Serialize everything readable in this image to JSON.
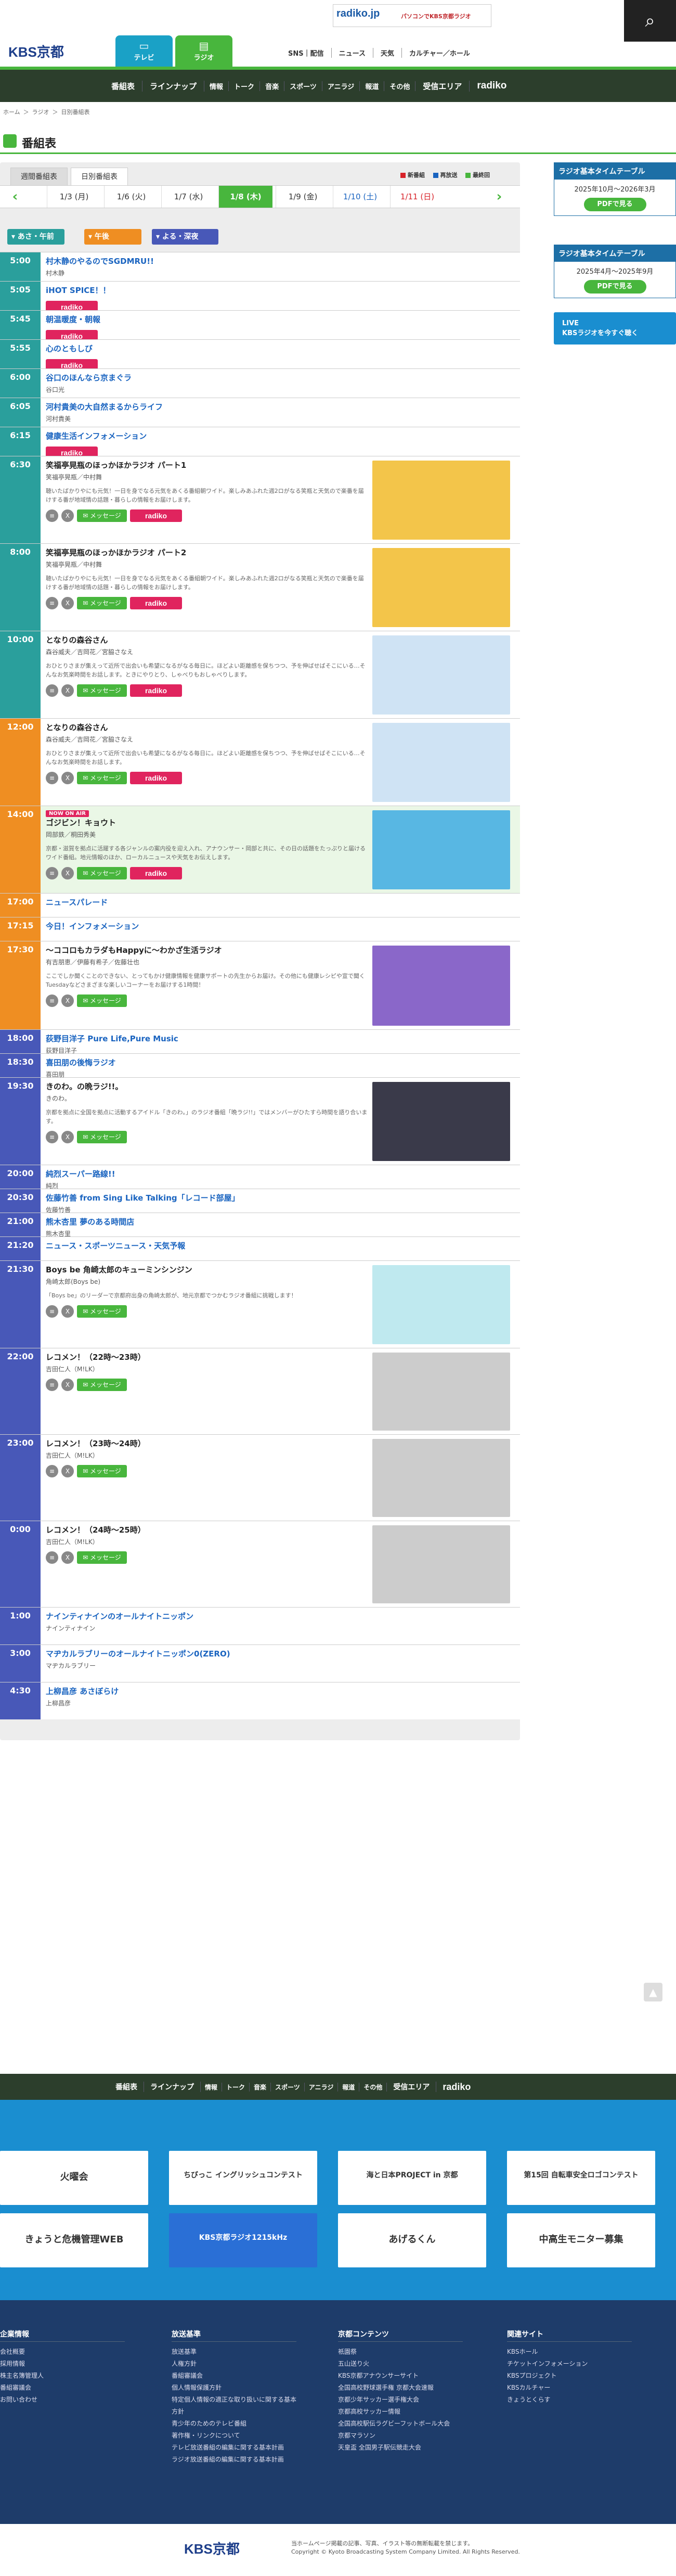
{
  "header": {
    "logo": "KBS京都",
    "tabs": [
      {
        "label": "テレビ",
        "icon": "tv-icon"
      },
      {
        "label": "ラジオ",
        "icon": "radio-icon"
      }
    ],
    "links": [
      "SNS｜配信",
      "ニュース",
      "天気",
      "カルチャー／ホール"
    ],
    "banner": {
      "brand": "radiko.jp",
      "text": "パソコンでKBS京都ラジオ"
    }
  },
  "gnav": [
    "番組表",
    "ラインナップ",
    "情報",
    "トーク",
    "音楽",
    "スポーツ",
    "アニラジ",
    "報道",
    "その他",
    "受信エリア",
    "radiko"
  ],
  "breadcrumb": [
    "ホーム",
    "＞",
    "ラジオ",
    "＞",
    "日別番組表"
  ],
  "page": {
    "title": "番組表"
  },
  "view_tabs": [
    "週間番組表",
    "日別番組表"
  ],
  "legend": [
    {
      "label": "新番組",
      "color": "#d8232a"
    },
    {
      "label": "再放送",
      "color": "#1a64c0"
    },
    {
      "label": "最終回",
      "color": "#48b63d"
    }
  ],
  "dates": [
    "1/3 (月)",
    "1/6 (火)",
    "1/7 (水)",
    "1/8 (木)",
    "1/9 (金)",
    "1/10 (土)",
    "1/11 (日)"
  ],
  "active_date": "1/8 (木)",
  "zones": [
    "あさ・午前",
    "午後",
    "よる・深夜"
  ],
  "programs": [
    {
      "time": "5:00",
      "title": "村木静のやるのでSGDMRU!!",
      "perf": "村木静",
      "zone": "morning",
      "radiko": true
    },
    {
      "time": "5:05",
      "title": "iHOT SPICE！！",
      "perf": "",
      "zone": "morning",
      "radiko": true
    },
    {
      "time": "5:45",
      "title": "朝温暖度・朝報",
      "perf": "",
      "zone": "morning",
      "radiko": true
    },
    {
      "time": "5:55",
      "title": "心のともしび",
      "perf": "",
      "zone": "morning",
      "radiko": true
    },
    {
      "time": "6:00",
      "title": "谷口のほんなら京まぐラ",
      "perf": "谷口光",
      "zone": "morning",
      "radiko": true
    },
    {
      "time": "6:05",
      "title": "河村貴美の大自然まるからライフ",
      "perf": "河村貴美",
      "zone": "morning",
      "radiko": true
    },
    {
      "time": "6:15",
      "title": "健康生活インフォメーション",
      "perf": "",
      "zone": "morning",
      "radiko": true
    },
    {
      "time": "6:30",
      "title": "笑福亭晃瓶のほっかほかラジオ パート1",
      "perf": "笑福亭晃瓶／中村舞",
      "desc": "聴いたばかりやにも元気！一日を身でなる元気をあくる番組朝ワイド。楽しみあふれた週2ロがなる笑瓶と天気ので楽番を届けする番が地域情の話題・暮らしの情報をお届けします。",
      "zone": "morning",
      "radiko": true,
      "msg": true,
      "thumb": "thumb-hokahoka-1"
    },
    {
      "time": "8:00",
      "title": "笑福亭晃瓶のほっかほかラジオ パート2",
      "perf": "笑福亭晃瓶／中村舞",
      "desc": "聴いたばかりやにも元気！一日を身でなる元気をあくる番組朝ワイド。楽しみあふれた週2ロがなる笑瓶と天気ので楽番を届けする番が地域情の話題・暮らしの情報をお届けします。",
      "zone": "morning",
      "radiko": true,
      "msg": true,
      "thumb": "thumb-hokahoka-2"
    },
    {
      "time": "10:00",
      "title": "となりの森谷さん",
      "perf": "森谷威夫／吉岡花／宮脇さなえ",
      "desc": "おひとりさまが集えって近所で出会いも希望になるがなる毎日に。ほどよい距離感を保ちつつ、予を伸ばせばそこにいる…そんなお気楽時間をお話します。ときにやりとり、しゃべりもおしゃべりします。",
      "zone": "morning",
      "radiko": true,
      "msg": true,
      "thumb": "thumb-moriya-1"
    },
    {
      "time": "12:00",
      "title": "となりの森谷さん",
      "perf": "森谷威夫／吉岡花／宮脇さなえ",
      "desc": "おひとりさまが集えって近所で出会いも希望になるがなる毎日に。ほどよい距離感を保ちつつ、予を伸ばせばそこにいる…そんなお気楽時間をお話します。",
      "zone": "afternoon",
      "radiko": true,
      "msg": true,
      "thumb": "thumb-moriya-2"
    },
    {
      "time": "14:00",
      "title": "ゴジビン！キョウト",
      "perf": "岡部鉄／桐田秀美",
      "desc": "京都・滋賀を拠点に活躍する各ジャンルの案内役を迎え入れ、アナウンサー・岡部と共に、その日の話題をたっぷりと届けるワイド番組。地元情報のほか、ローカルニュースや天気をお伝えします。",
      "zone": "afternoon",
      "onair": true,
      "radiko": true,
      "msg": true,
      "thumb": "thumb-gojibin"
    },
    {
      "time": "17:00",
      "title": "ニュースパレード",
      "perf": "",
      "zone": "afternoon"
    },
    {
      "time": "17:15",
      "title": "今日！インフォメーション",
      "perf": "",
      "zone": "afternoon"
    },
    {
      "time": "17:30",
      "title": "〜ココロもカラダもHappyに〜わかざ生活ラジオ",
      "perf": "有吉朋恵／伊藤有希子／佐藤壮也",
      "desc": "ここでしか聞くことのできない、とってもかけ健康情報を健康サポートの先生からお届け。その他にも健康レシピや宣で聞く Tuesdayなどさまざまな楽しいコーナーをお届けする1時間！",
      "zone": "afternoon",
      "msg": true,
      "thumb": "thumb-wakasa"
    },
    {
      "time": "18:00",
      "title": "荻野目洋子 Pure Life,Pure Music",
      "perf": "荻野目洋子",
      "zone": "evening"
    },
    {
      "time": "18:30",
      "title": "喜田朋の後悔ラジオ",
      "perf": "喜田朋",
      "zone": "evening"
    },
    {
      "time": "19:30",
      "title": "きのわ。の晩ラジ!!。",
      "perf": "きのわ。",
      "desc": "京都を拠点に全国を拠点に活動するアイドル「きのわ。」のラジオ番組「晩ラジ!!」ではメンバーがひたすら時間を語り合います。",
      "zone": "evening",
      "msg": true,
      "thumb": "thumb-kinowa"
    },
    {
      "time": "20:00",
      "title": "純烈スーパー路線!!",
      "perf": "純烈",
      "zone": "evening"
    },
    {
      "time": "20:30",
      "title": "佐藤竹善 from Sing Like Talking「レコード部屋」",
      "perf": "佐藤竹善",
      "zone": "evening"
    },
    {
      "time": "21:00",
      "title": "熊木杏里 夢のある時間店",
      "perf": "熊木杏里",
      "zone": "evening"
    },
    {
      "time": "21:20",
      "title": "ニュース・スポーツニュース・天気予報",
      "perf": "",
      "zone": "evening"
    },
    {
      "time": "21:30",
      "title": "Boys be 角崎太郎のキューミンシンジン",
      "perf": "角崎太郎(Boys be)",
      "desc": "「Boys be」のリーダーで京都府出身の角崎太郎が、地元京都でつかむラジオ番組に挑戦します！",
      "zone": "evening",
      "msg": true,
      "thumb": "thumb-kyumin"
    },
    {
      "time": "22:00",
      "title": "レコメン！（22時〜23時）",
      "perf": "吉田仁人（M!LK）",
      "zone": "evening",
      "msg": true,
      "thumb": "thumb-recomen-1"
    },
    {
      "time": "23:00",
      "title": "レコメン！（23時〜24時）",
      "perf": "吉田仁人（M!LK）",
      "zone": "evening",
      "msg": true,
      "thumb": "thumb-recomen-2"
    },
    {
      "time": "0:00",
      "title": "レコメン！（24時〜25時）",
      "perf": "吉田仁人（M!LK）",
      "zone": "evening",
      "msg": true,
      "thumb": "thumb-recomen-3"
    },
    {
      "time": "1:00",
      "title": "ナインティナインのオールナイトニッポン",
      "perf": "ナインティナイン",
      "zone": "evening"
    },
    {
      "time": "3:00",
      "title": "マヂカルラブリーのオールナイトニッポン0(ZERO)",
      "perf": "マヂカルラブリー",
      "zone": "evening"
    },
    {
      "time": "4:30",
      "title": "上柳昌彦 あさぼらけ",
      "perf": "上柳昌彦",
      "zone": "evening"
    }
  ],
  "labels": {
    "radiko": "radiko",
    "message": "メッセージ",
    "onair": "NOW ON AIR",
    "recomen": "レコメン!"
  },
  "sidebar": [
    {
      "title": "ラジオ基本タイムテーブル",
      "period": "2025年10月〜2026年3月",
      "btn": "PDFで見る"
    },
    {
      "title": "ラジオ基本タイムテーブル",
      "period": "2025年4月〜2025年9月",
      "btn": "PDFで見る"
    }
  ],
  "live": {
    "line1": "LIVE",
    "line2": "KBSラジオを今すぐ聴く"
  },
  "banners": [
    "火曜会",
    "ちびっこ イングリッシュコンテスト",
    "海と日本PROJECT in 京都",
    "第15回 自転車安全ロゴコンテスト",
    "きょうと危機管理WEB",
    "KBS京都ラジオ1215kHz",
    "あげるくん",
    "中高生モニター募集"
  ],
  "footer_links": [
    {
      "head": "企業情報",
      "items": [
        "会社概要",
        "採用情報",
        "株主名簿管理人",
        "番組審議会",
        "お問い合わせ"
      ]
    },
    {
      "head": "放送基準",
      "items": [
        "放送基準",
        "人権方針",
        "番組審議会",
        "個人情報保護方針",
        "特定個人情報の適正な取り扱いに関する基本方針",
        "青少年のためのテレビ番組",
        "著作権・リンクについて",
        "テレビ放送番組の編集に関する基本計画",
        "ラジオ放送番組の編集に関する基本計画"
      ]
    },
    {
      "head": "京都コンテンツ",
      "items": [
        "祇園祭",
        "五山送り火",
        "KBS京都アナウンサーサイト",
        "全国高校野球選手権 京都大会速報",
        "京都少年サッカー選手権大会",
        "京都高校サッカー情報",
        "全国高校駅伝ラグビーフットボール大会",
        "京都マラソン",
        "天皇盃 全国男子駅伝競走大会"
      ]
    },
    {
      "head": "関連サイト",
      "items": [
        "KBSホール",
        "チケットインフォメーション",
        "KBSプロジェクト",
        "KBSカルチャー",
        "きょうとくらす"
      ]
    }
  ],
  "copyright": {
    "logo": "KBS京都",
    "line1": "当ホームページ掲載の記事、写真、イラスト等の無断転載を禁じます。",
    "line2": "Copyright © Kyoto Broadcasting System Company Limited. All Rights Reserved."
  }
}
